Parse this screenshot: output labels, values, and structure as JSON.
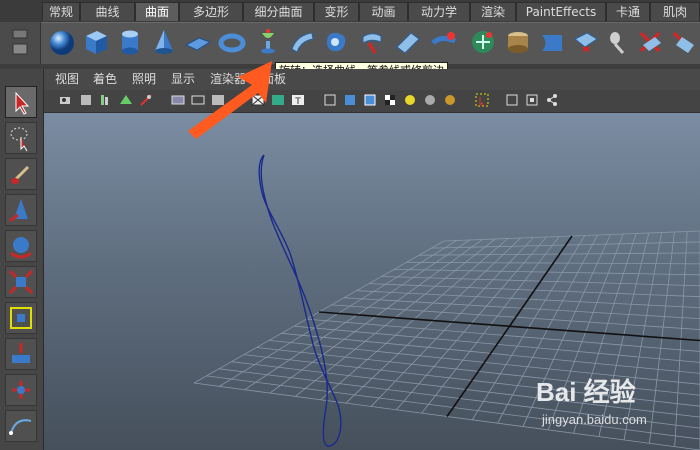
{
  "shelf": {
    "tabs": [
      {
        "label": "常规",
        "active": false
      },
      {
        "label": "曲线",
        "active": false
      },
      {
        "label": "曲面",
        "active": true
      },
      {
        "label": "多边形",
        "active": false
      },
      {
        "label": "细分曲面",
        "active": false
      },
      {
        "label": "变形",
        "active": false
      },
      {
        "label": "动画",
        "active": false
      },
      {
        "label": "动力学",
        "active": false
      },
      {
        "label": "渲染",
        "active": false
      },
      {
        "label": "PaintEffects",
        "active": false
      },
      {
        "label": "卡通",
        "active": false
      },
      {
        "label": "肌肉",
        "active": false
      }
    ],
    "icons": [
      "sphere-icon",
      "cube-icon",
      "cylinder-icon",
      "cone-icon",
      "plane-icon",
      "torus-icon",
      "revolve-icon",
      "loft-icon",
      "planar-icon",
      "extrude-icon",
      "birail-icon",
      "boundary-icon",
      "square-icon",
      "bevel-icon",
      "project-curve-icon",
      "intersect-icon",
      "trim-icon",
      "untrim-icon",
      "attach-icon",
      "detach-icon",
      "insert-isoparm-icon",
      "sculpt-icon"
    ]
  },
  "tooltip": {
    "text": "旋转：选择曲线、等参线或修剪边"
  },
  "panel": {
    "menu": {
      "view": "视图",
      "shading": "着色",
      "lighting": "照明",
      "show": "显示",
      "renderer": "渲染器",
      "panels": "面板"
    }
  },
  "watermark": {
    "logo": "Bai 经验",
    "url": "jingyan.baidu.com"
  },
  "colors": {
    "accent": "#ff5a1f",
    "curve": "#1a2a8c",
    "grid": "#8a96a6",
    "axis": "#111111"
  }
}
